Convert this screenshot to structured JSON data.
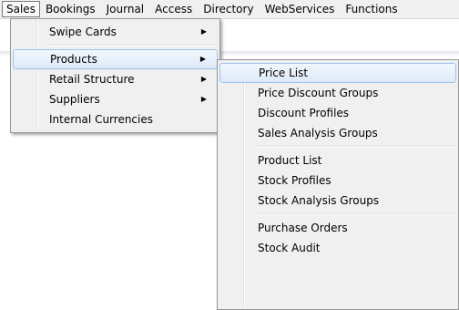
{
  "menubar": {
    "items": [
      {
        "label": "Sales",
        "active": true
      },
      {
        "label": "Bookings"
      },
      {
        "label": "Journal"
      },
      {
        "label": "Access"
      },
      {
        "label": "Directory"
      },
      {
        "label": "WebServices"
      },
      {
        "label": "Functions"
      }
    ]
  },
  "sales_menu": {
    "items": [
      {
        "label": "Swipe Cards",
        "has_submenu": true
      },
      {
        "label": "Products",
        "has_submenu": true,
        "highlighted": true
      },
      {
        "label": "Retail Structure",
        "has_submenu": true
      },
      {
        "label": "Suppliers",
        "has_submenu": true
      },
      {
        "label": "Internal Currencies",
        "has_submenu": false
      }
    ]
  },
  "products_menu": {
    "items": [
      {
        "label": "Price List",
        "highlighted": true
      },
      {
        "label": "Price Discount Groups"
      },
      {
        "label": "Discount Profiles"
      },
      {
        "label": "Sales Analysis Groups"
      },
      {
        "label": "Product List"
      },
      {
        "label": "Stock Profiles"
      },
      {
        "label": "Stock Analysis Groups"
      },
      {
        "label": "Purchase Orders"
      },
      {
        "label": "Stock Audit"
      }
    ]
  },
  "icons": {
    "submenu_arrow": "▶"
  },
  "colors": {
    "menu_background": "#f0f0f0",
    "highlight_border": "#9ec3ea",
    "highlight_fill": "#dde9f8"
  }
}
